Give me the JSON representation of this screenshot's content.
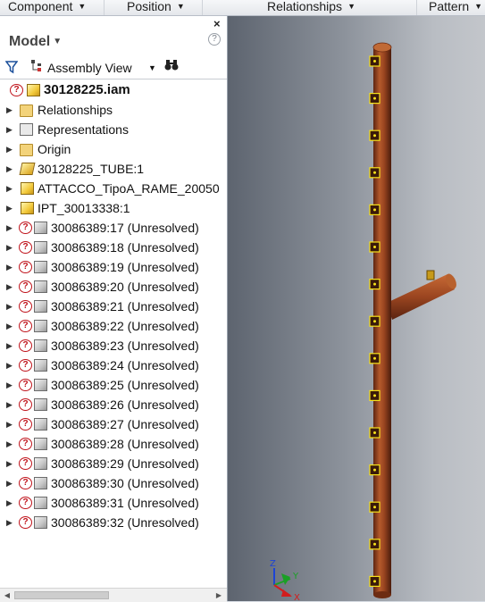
{
  "ribbon": {
    "panels": [
      {
        "label": "Component"
      },
      {
        "label": "Position"
      },
      {
        "label": "Relationships"
      },
      {
        "label": "Pattern"
      }
    ]
  },
  "browser": {
    "title": "Model",
    "close_glyph": "×",
    "help_glyph": "?",
    "view_label": "Assembly View",
    "icons": {
      "filter": "filter-icon",
      "assembly": "assembly-view-icon",
      "find": "binoculars-icon"
    },
    "tree": [
      {
        "label": "30128225.iam",
        "icon": "assembly-unresolved",
        "root": true
      },
      {
        "label": "Relationships",
        "icon": "folder"
      },
      {
        "label": "Representations",
        "icon": "representations"
      },
      {
        "label": "Origin",
        "icon": "folder"
      },
      {
        "label": "30128225_TUBE:1",
        "icon": "tube-part"
      },
      {
        "label": "ATTACCO_TipoA_RAME_20050",
        "icon": "part-yellow"
      },
      {
        "label": "IPT_30013338:1",
        "icon": "part-yellow"
      },
      {
        "label": "30086389:17 (Unresolved)",
        "icon": "unresolved-part"
      },
      {
        "label": "30086389:18 (Unresolved)",
        "icon": "unresolved-part"
      },
      {
        "label": "30086389:19 (Unresolved)",
        "icon": "unresolved-part"
      },
      {
        "label": "30086389:20 (Unresolved)",
        "icon": "unresolved-part"
      },
      {
        "label": "30086389:21 (Unresolved)",
        "icon": "unresolved-part"
      },
      {
        "label": "30086389:22 (Unresolved)",
        "icon": "unresolved-part"
      },
      {
        "label": "30086389:23 (Unresolved)",
        "icon": "unresolved-part"
      },
      {
        "label": "30086389:24 (Unresolved)",
        "icon": "unresolved-part"
      },
      {
        "label": "30086389:25 (Unresolved)",
        "icon": "unresolved-part"
      },
      {
        "label": "30086389:26 (Unresolved)",
        "icon": "unresolved-part"
      },
      {
        "label": "30086389:27 (Unresolved)",
        "icon": "unresolved-part"
      },
      {
        "label": "30086389:28 (Unresolved)",
        "icon": "unresolved-part"
      },
      {
        "label": "30086389:29 (Unresolved)",
        "icon": "unresolved-part"
      },
      {
        "label": "30086389:30 (Unresolved)",
        "icon": "unresolved-part"
      },
      {
        "label": "30086389:31 (Unresolved)",
        "icon": "unresolved-part"
      },
      {
        "label": "30086389:32 (Unresolved)",
        "icon": "unresolved-part"
      }
    ]
  },
  "viewport": {
    "model": "copper-pipe-assembly",
    "colors": {
      "copper": "#8e3a17",
      "copper_light": "#c0622e",
      "highlight": "#f7e21a"
    },
    "triad": {
      "x": "X",
      "y": "Y",
      "z": "Z"
    }
  }
}
